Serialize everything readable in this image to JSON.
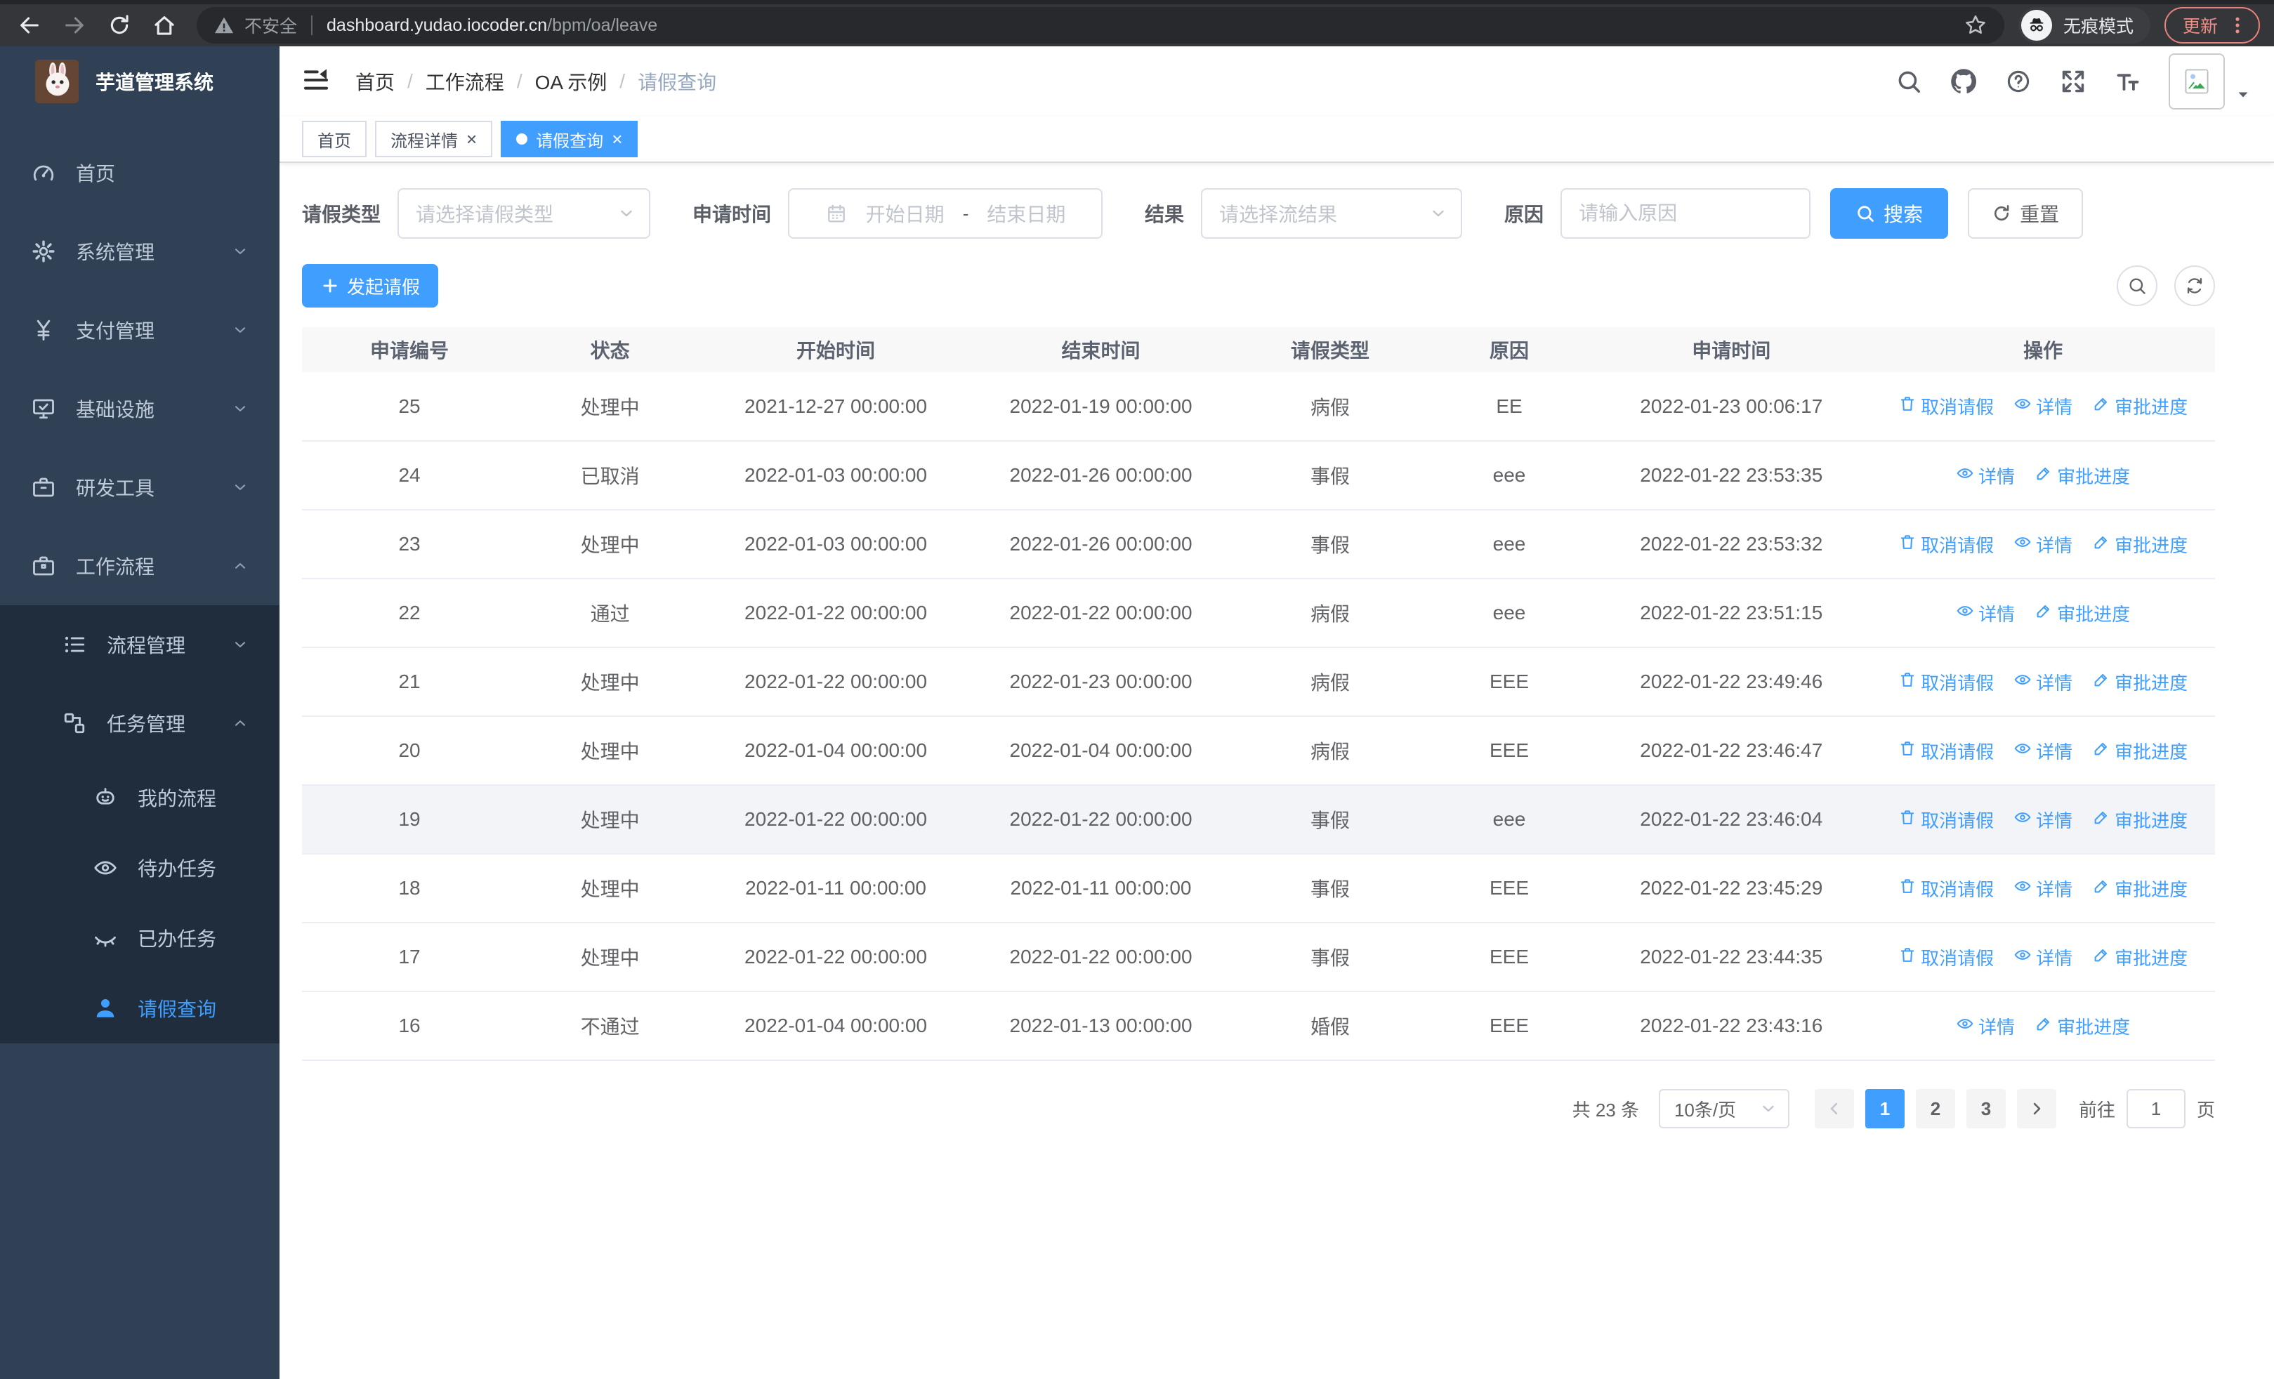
{
  "browser": {
    "security_label": "不安全",
    "url_domain": "dashboard.yudao.iocoder.cn",
    "url_path": "/bpm/oa/leave",
    "incognito_label": "无痕模式",
    "update_label": "更新"
  },
  "colors": {
    "accent": "#409eff",
    "sidebar_bg": "#304156",
    "submenu_bg": "#1f2d3d",
    "sidebar_text": "#bfcbd9",
    "update_red": "#ee8e88"
  },
  "sidebar": {
    "app_title": "芋道管理系统",
    "items": [
      {
        "key": "home",
        "label": "首页",
        "icon": "dashboard-icon",
        "level": 1,
        "expand": null,
        "submenu": false,
        "active": false
      },
      {
        "key": "system",
        "label": "系统管理",
        "icon": "gear-icon",
        "level": 1,
        "expand": "down",
        "submenu": false,
        "active": false
      },
      {
        "key": "payment",
        "label": "支付管理",
        "icon": "yuan-icon",
        "level": 1,
        "expand": "down",
        "submenu": false,
        "active": false
      },
      {
        "key": "infra",
        "label": "基础设施",
        "icon": "monitor-icon",
        "level": 1,
        "expand": "down",
        "submenu": false,
        "active": false
      },
      {
        "key": "devtools",
        "label": "研发工具",
        "icon": "toolbox-icon",
        "level": 1,
        "expand": "down",
        "submenu": false,
        "active": false
      },
      {
        "key": "workflow",
        "label": "工作流程",
        "icon": "briefcase-icon",
        "level": 1,
        "expand": "up",
        "submenu": false,
        "active": false
      },
      {
        "key": "process-mgmt",
        "label": "流程管理",
        "icon": "list-icon",
        "level": 2,
        "expand": "down",
        "submenu": true,
        "active": false
      },
      {
        "key": "task-mgmt",
        "label": "任务管理",
        "icon": "flow-icon",
        "level": 2,
        "expand": "up",
        "submenu": true,
        "active": false
      },
      {
        "key": "my-process",
        "label": "我的流程",
        "icon": "robot-icon",
        "level": 3,
        "expand": null,
        "submenu": true,
        "active": false
      },
      {
        "key": "todo-task",
        "label": "待办任务",
        "icon": "eye-open-icon",
        "level": 3,
        "expand": null,
        "submenu": true,
        "active": false
      },
      {
        "key": "done-task",
        "label": "已办任务",
        "icon": "eye-closed-icon",
        "level": 3,
        "expand": null,
        "submenu": true,
        "active": false
      },
      {
        "key": "leave-query",
        "label": "请假查询",
        "icon": "user-icon",
        "level": 3,
        "expand": null,
        "submenu": true,
        "active": true
      }
    ]
  },
  "header": {
    "breadcrumb": [
      "首页",
      "工作流程",
      "OA 示例",
      "请假查询"
    ]
  },
  "tabs": [
    {
      "key": "home",
      "label": "首页",
      "closable": false,
      "active": false
    },
    {
      "key": "process-detail",
      "label": "流程详情",
      "closable": true,
      "active": false
    },
    {
      "key": "leave-query",
      "label": "请假查询",
      "closable": true,
      "active": true
    }
  ],
  "filters": {
    "leave_type": {
      "label": "请假类型",
      "placeholder": "请选择请假类型"
    },
    "apply_time": {
      "label": "申请时间",
      "start_placeholder": "开始日期",
      "separator": "-",
      "end_placeholder": "结束日期"
    },
    "result": {
      "label": "结果",
      "placeholder": "请选择流结果"
    },
    "reason": {
      "label": "原因",
      "placeholder": "请输入原因"
    },
    "search_label": "搜索",
    "reset_label": "重置"
  },
  "toolbar": {
    "create_label": "发起请假"
  },
  "table": {
    "columns": [
      "申请编号",
      "状态",
      "开始时间",
      "结束时间",
      "请假类型",
      "原因",
      "申请时间",
      "操作"
    ],
    "action_labels": {
      "cancel": "取消请假",
      "detail": "详情",
      "progress": "审批进度"
    },
    "rows": [
      {
        "id": "25",
        "status": "处理中",
        "start": "2021-12-27 00:00:00",
        "end": "2022-01-19 00:00:00",
        "type": "病假",
        "reason": "EE",
        "apply_time": "2022-01-23 00:06:17",
        "cancelable": true,
        "highlight": false
      },
      {
        "id": "24",
        "status": "已取消",
        "start": "2022-01-03 00:00:00",
        "end": "2022-01-26 00:00:00",
        "type": "事假",
        "reason": "eee",
        "apply_time": "2022-01-22 23:53:35",
        "cancelable": false,
        "highlight": false
      },
      {
        "id": "23",
        "status": "处理中",
        "start": "2022-01-03 00:00:00",
        "end": "2022-01-26 00:00:00",
        "type": "事假",
        "reason": "eee",
        "apply_time": "2022-01-22 23:53:32",
        "cancelable": true,
        "highlight": false
      },
      {
        "id": "22",
        "status": "通过",
        "start": "2022-01-22 00:00:00",
        "end": "2022-01-22 00:00:00",
        "type": "病假",
        "reason": "eee",
        "apply_time": "2022-01-22 23:51:15",
        "cancelable": false,
        "highlight": false
      },
      {
        "id": "21",
        "status": "处理中",
        "start": "2022-01-22 00:00:00",
        "end": "2022-01-23 00:00:00",
        "type": "病假",
        "reason": "EEE",
        "apply_time": "2022-01-22 23:49:46",
        "cancelable": true,
        "highlight": false
      },
      {
        "id": "20",
        "status": "处理中",
        "start": "2022-01-04 00:00:00",
        "end": "2022-01-04 00:00:00",
        "type": "病假",
        "reason": "EEE",
        "apply_time": "2022-01-22 23:46:47",
        "cancelable": true,
        "highlight": false
      },
      {
        "id": "19",
        "status": "处理中",
        "start": "2022-01-22 00:00:00",
        "end": "2022-01-22 00:00:00",
        "type": "事假",
        "reason": "eee",
        "apply_time": "2022-01-22 23:46:04",
        "cancelable": true,
        "highlight": true
      },
      {
        "id": "18",
        "status": "处理中",
        "start": "2022-01-11 00:00:00",
        "end": "2022-01-11 00:00:00",
        "type": "事假",
        "reason": "EEE",
        "apply_time": "2022-01-22 23:45:29",
        "cancelable": true,
        "highlight": false
      },
      {
        "id": "17",
        "status": "处理中",
        "start": "2022-01-22 00:00:00",
        "end": "2022-01-22 00:00:00",
        "type": "事假",
        "reason": "EEE",
        "apply_time": "2022-01-22 23:44:35",
        "cancelable": true,
        "highlight": false
      },
      {
        "id": "16",
        "status": "不通过",
        "start": "2022-01-04 00:00:00",
        "end": "2022-01-13 00:00:00",
        "type": "婚假",
        "reason": "EEE",
        "apply_time": "2022-01-22 23:43:16",
        "cancelable": false,
        "highlight": false
      }
    ]
  },
  "pagination": {
    "total": "共 23 条",
    "page_size": "10条/页",
    "pages": [
      "1",
      "2",
      "3"
    ],
    "active_page": "1",
    "goto_label": "前往",
    "goto_value": "1",
    "unit_label": "页"
  }
}
